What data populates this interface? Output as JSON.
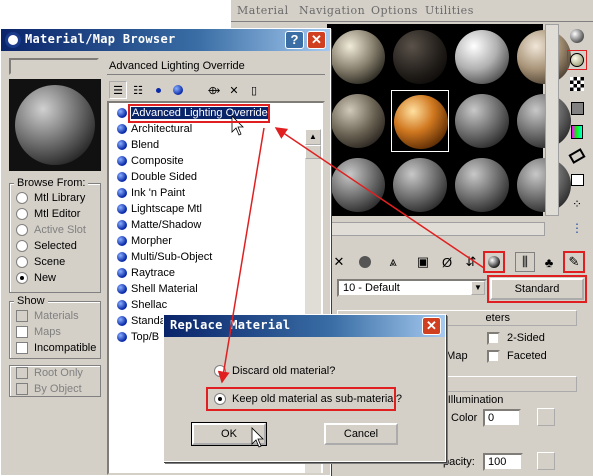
{
  "material_editor": {
    "menu": [
      "Material",
      "Navigation",
      "Options",
      "Utilities"
    ],
    "material_dropdown": "10 - Default",
    "type_button": "Standard",
    "rollout": {
      "params_header": "eters",
      "two_sided": "2-Sided",
      "face_map": "e Map",
      "faceted": "Faceted",
      "params_header2": "ters",
      "self_illum": "f-Illumination",
      "color_label": "Color",
      "color_value": "0",
      "opacity_label": "pacity:",
      "opacity_value": "100"
    }
  },
  "browser": {
    "title": "Material/Map Browser",
    "path_label": "Advanced Lighting Override",
    "browse_from": {
      "title": "Browse From:",
      "options": [
        "Mtl Library",
        "Mtl Editor",
        "Active Slot",
        "Selected",
        "Scene",
        "New"
      ],
      "selected": "New"
    },
    "show": {
      "title": "Show",
      "options": [
        "Materials",
        "Maps",
        "Incompatible"
      ],
      "options2": [
        "Root Only",
        "By Object"
      ]
    },
    "materials": [
      "Advanced Lighting Override",
      "Architectural",
      "Blend",
      "Composite",
      "Double Sided",
      "Ink 'n Paint",
      "Lightscape Mtl",
      "Matte/Shadow",
      "Morpher",
      "Multi/Sub-Object",
      "Raytrace",
      "Shell Material",
      "Shellac",
      "Standa",
      "Top/B"
    ]
  },
  "dialog": {
    "title": "Replace Material",
    "option_discard": "Discard old material?",
    "option_keep": "Keep old material as sub-material?",
    "ok_label": "OK",
    "cancel_label": "Cancel"
  },
  "colors": {
    "titlebar": "#0a246a",
    "highlight": "#e02020",
    "face": "#d4d0c8"
  }
}
